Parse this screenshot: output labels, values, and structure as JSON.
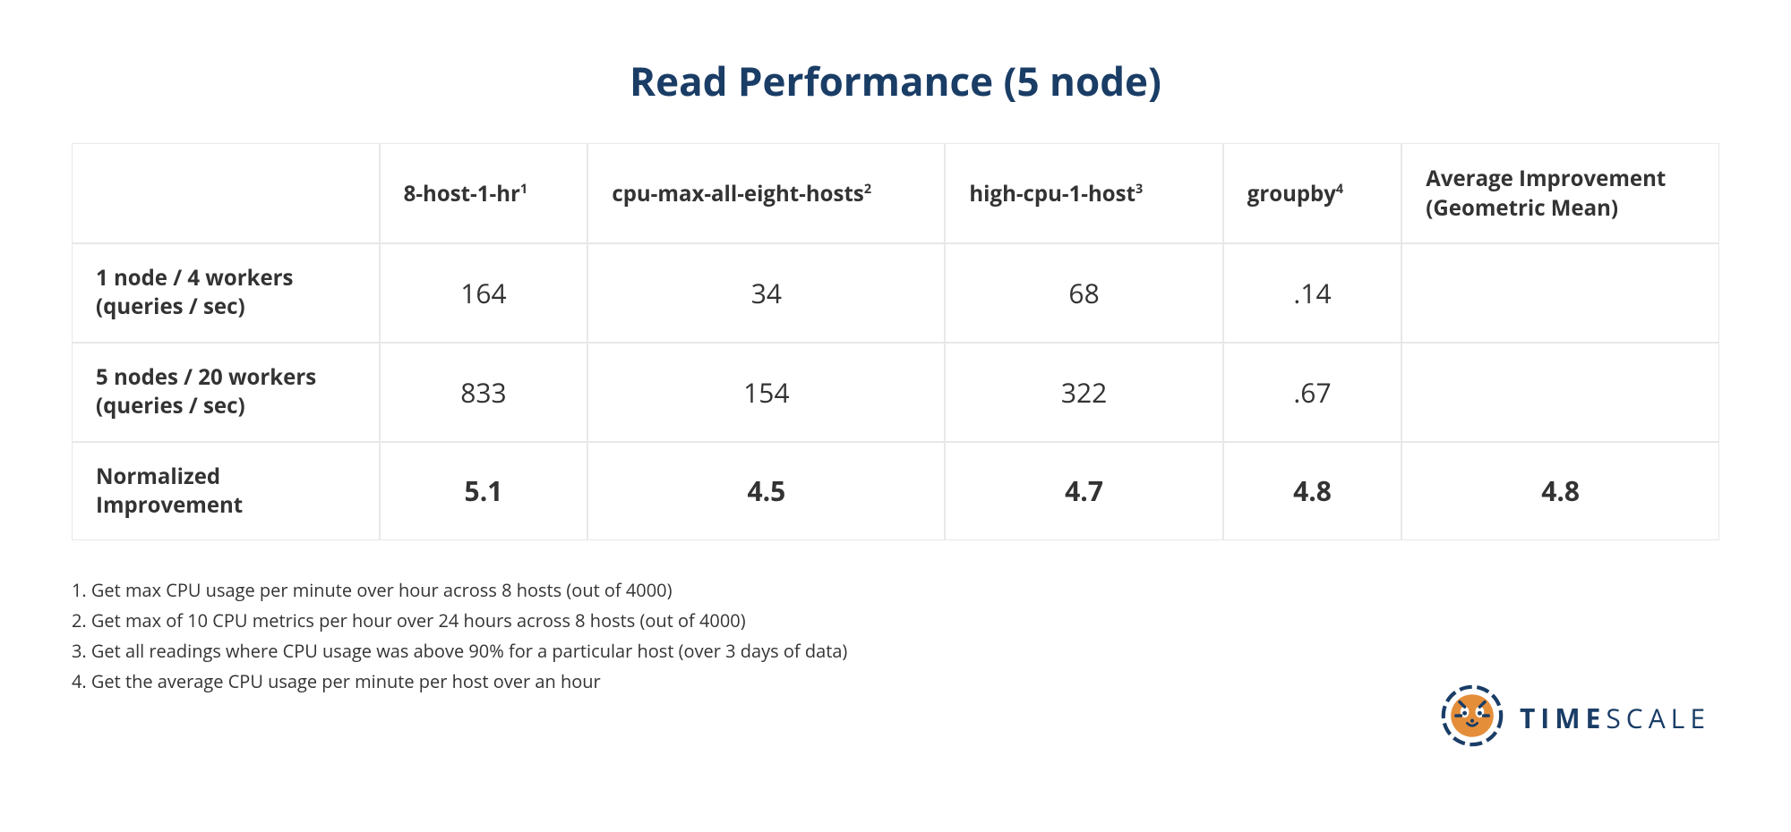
{
  "title": "Read Performance (5 node)",
  "columns": [
    {
      "label": "8-host-1-hr",
      "sup": "1"
    },
    {
      "label": "cpu-max-all-eight-hosts",
      "sup": "2"
    },
    {
      "label": "high-cpu-1-host",
      "sup": "3"
    },
    {
      "label": "groupby",
      "sup": "4"
    },
    {
      "label": "Average Improvement (Geometric Mean)",
      "sup": ""
    }
  ],
  "rows": [
    {
      "label_line1": "1 node / 4 workers",
      "label_line2": "(queries / sec)",
      "values": [
        "164",
        "34",
        "68",
        ".14",
        ""
      ],
      "bold": false
    },
    {
      "label_line1": "5 nodes / 20 workers",
      "label_line2": "(queries / sec)",
      "values": [
        "833",
        "154",
        "322",
        ".67",
        ""
      ],
      "bold": false
    },
    {
      "label_line1": "Normalized",
      "label_line2": "Improvement",
      "values": [
        "5.1",
        "4.5",
        "4.7",
        "4.8",
        "4.8"
      ],
      "bold": true
    }
  ],
  "footnotes": [
    "1. Get max CPU usage per minute over hour across 8 hosts (out of 4000)",
    "2. Get max of 10 CPU metrics per hour over 24 hours across 8 hosts (out of 4000)",
    "3. Get all readings where CPU usage was above 90% for a particular host (over 3 days of data)",
    "4. Get the average CPU usage per minute per host over an hour"
  ],
  "brand": {
    "part1": "TIME",
    "part2": "SCALE"
  },
  "chart_data": {
    "type": "table",
    "title": "Read Performance (5 node)",
    "columns": [
      "8-host-1-hr",
      "cpu-max-all-eight-hosts",
      "high-cpu-1-host",
      "groupby",
      "Average Improvement (Geometric Mean)"
    ],
    "rows": [
      {
        "name": "1 node / 4 workers (queries / sec)",
        "values": [
          164,
          34,
          68,
          0.14,
          null
        ]
      },
      {
        "name": "5 nodes / 20 workers (queries / sec)",
        "values": [
          833,
          154,
          322,
          0.67,
          null
        ]
      },
      {
        "name": "Normalized Improvement",
        "values": [
          5.1,
          4.5,
          4.7,
          4.8,
          4.8
        ]
      }
    ],
    "footnotes": {
      "1": "Get max CPU usage per minute over hour across 8 hosts (out of 4000)",
      "2": "Get max of 10 CPU metrics per hour over 24 hours across 8 hosts (out of 4000)",
      "3": "Get all readings where CPU usage was above 90% for a particular host (over 3 days of data)",
      "4": "Get the average CPU usage per minute per host over an hour"
    }
  }
}
